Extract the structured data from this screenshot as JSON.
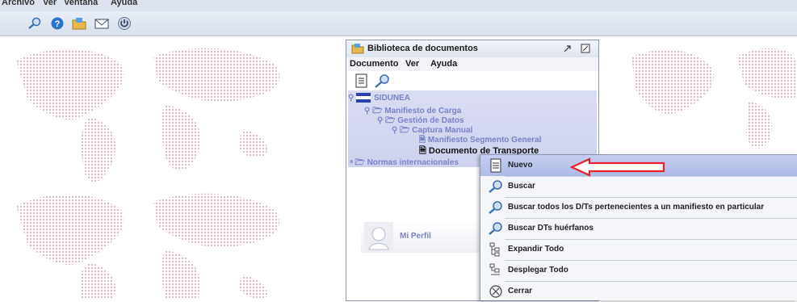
{
  "menubar": {
    "items": [
      "Archivo",
      "Ver",
      "Ventana",
      "Ayuda"
    ]
  },
  "toolbar": {
    "icons": [
      "search-icon",
      "help-icon",
      "folder-icon",
      "mail-icon",
      "power-icon"
    ]
  },
  "doclib": {
    "title": "Biblioteca de documentos",
    "menu": [
      "Documento",
      "Ver",
      "Ayuda"
    ],
    "tree": {
      "root": "SIDUNEA",
      "manifiesto": "Manifiesto de Carga",
      "gestion": "Gestión de Datos",
      "captura": "Captura Manual",
      "segmento": "Manifiesto Segmento General",
      "documento": "Documento de Transporte",
      "normas": "Normas internacionales",
      "perfil": "Mi Perfil"
    }
  },
  "context_menu": {
    "items": [
      {
        "label": "Nuevo",
        "icon": "document-icon",
        "highlighted": true
      },
      {
        "label": "Buscar",
        "icon": "search-icon"
      },
      {
        "label": "Buscar todos los D/Ts pertenecientes a un manifiesto en particular",
        "icon": "search-icon"
      },
      {
        "label": "Buscar DTs huérfanos",
        "icon": "search-icon"
      },
      {
        "label": "Expandir Todo",
        "icon": "expand-tree-icon"
      },
      {
        "label": "Desplegar Todo",
        "icon": "collapse-tree-icon"
      },
      {
        "label": "Cerrar",
        "icon": "close-circle-icon"
      }
    ]
  },
  "colors": {
    "accent": "#aebbe8",
    "arrow": "#e8202a",
    "tree_text": "#7a82c8"
  }
}
